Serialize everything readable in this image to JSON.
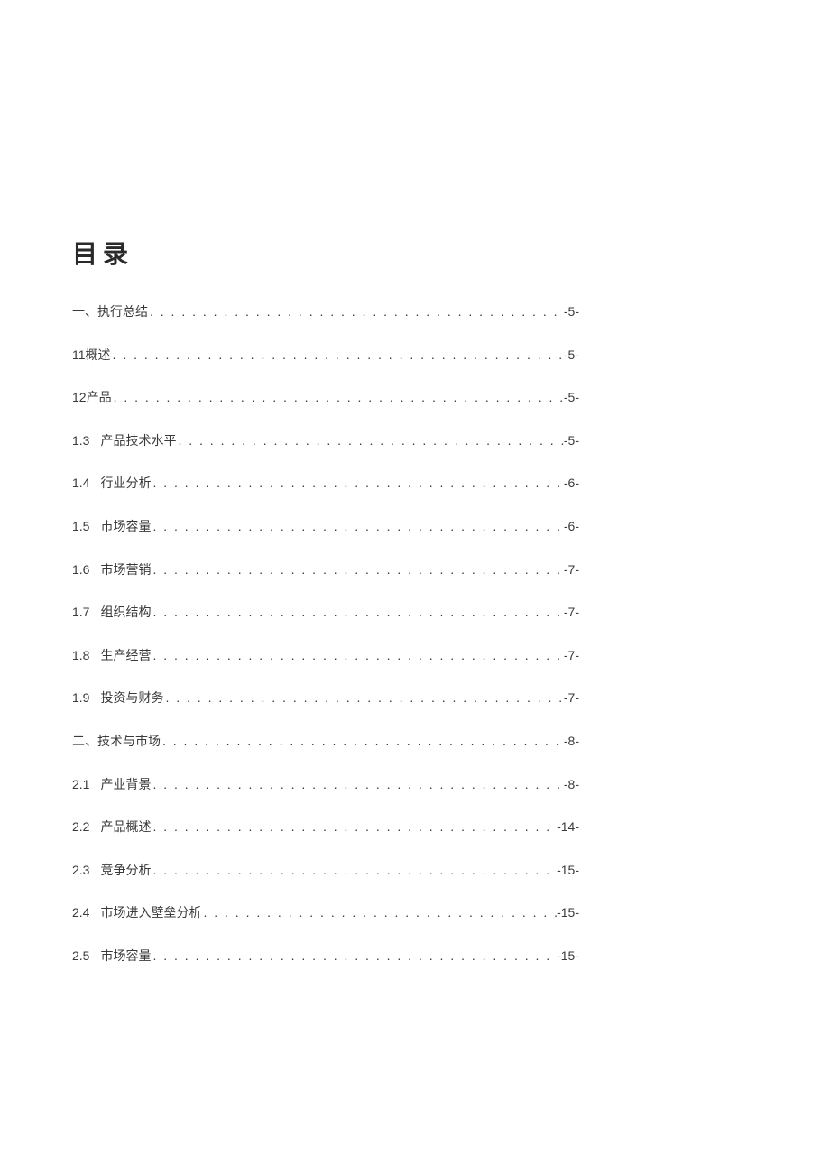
{
  "toc": {
    "title": "目录",
    "entries": [
      {
        "num": "一、",
        "label": "执行总结",
        "page": "-5-",
        "indent": false
      },
      {
        "num": "11",
        "label": "概述",
        "page": "-5-",
        "indent": false
      },
      {
        "num": "12",
        "label": "产品",
        "page": "-5-",
        "indent": false
      },
      {
        "num": "1.3",
        "label": "产品技术水平",
        "page": "-5-",
        "indent": true
      },
      {
        "num": "1.4",
        "label": "行业分析",
        "page": "-6-",
        "indent": true
      },
      {
        "num": "1.5",
        "label": "市场容量",
        "page": "-6-",
        "indent": true
      },
      {
        "num": "1.6",
        "label": "市场营销",
        "page": "-7-",
        "indent": true
      },
      {
        "num": "1.7",
        "label": "组织结构",
        "page": "-7-",
        "indent": true
      },
      {
        "num": "1.8",
        "label": "生产经营",
        "page": "-7-",
        "indent": true
      },
      {
        "num": "1.9",
        "label": "投资与财务",
        "page": "-7-",
        "indent": true
      },
      {
        "num": "二、",
        "label": "技术与市场",
        "page": "-8-",
        "indent": false
      },
      {
        "num": "2.1",
        "label": "产业背景",
        "page": "-8-",
        "indent": true
      },
      {
        "num": "2.2",
        "label": "产品概述",
        "page": "-14-",
        "indent": true
      },
      {
        "num": "2.3",
        "label": "竞争分析",
        "page": "-15-",
        "indent": true
      },
      {
        "num": "2.4",
        "label": "市场进入壁垒分析",
        "page": "-15-",
        "indent": true
      },
      {
        "num": "2.5",
        "label": "市场容量",
        "page": "-15-",
        "indent": true
      }
    ]
  }
}
